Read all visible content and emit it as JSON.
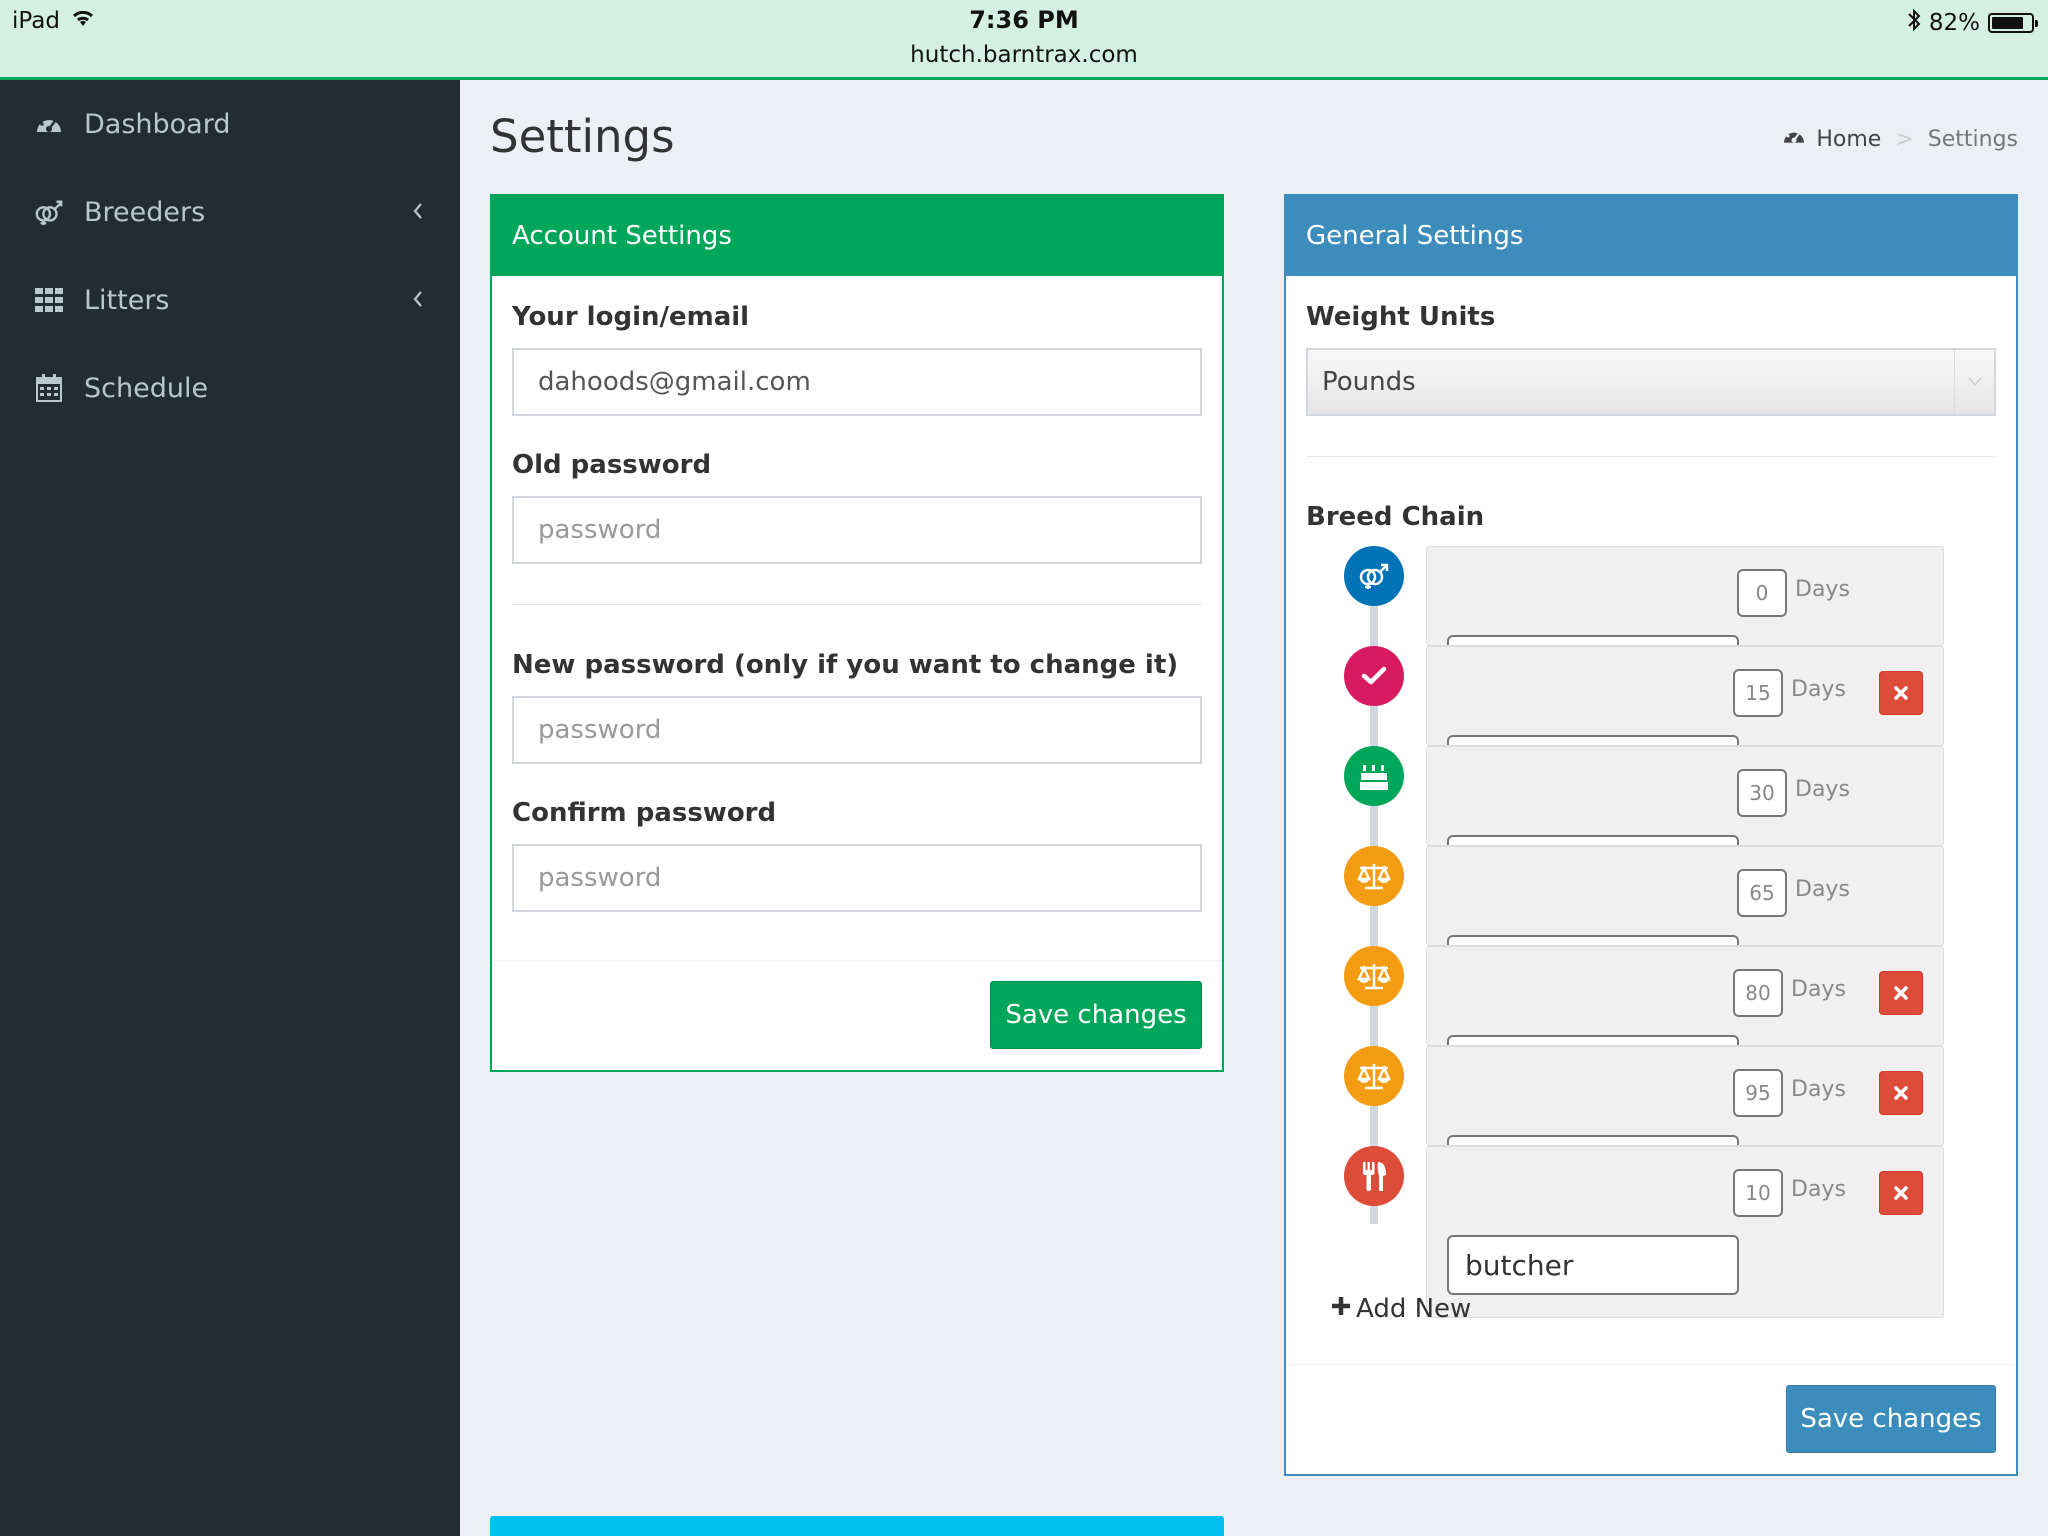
{
  "status_bar": {
    "device": "iPad",
    "time": "7:36 PM",
    "url": "hutch.barntrax.com",
    "battery": "82%",
    "battery_level": 0.82
  },
  "sidebar": {
    "items": [
      {
        "label": "Dashboard",
        "icon": "dashboard-icon"
      },
      {
        "label": "Breeders",
        "icon": "breeders-icon",
        "expandable": true
      },
      {
        "label": "Litters",
        "icon": "grid-icon",
        "expandable": true
      },
      {
        "label": "Schedule",
        "icon": "calendar-icon"
      }
    ]
  },
  "header": {
    "title": "Settings",
    "breadcrumb": {
      "home": "Home",
      "separator": ">",
      "current": "Settings"
    }
  },
  "account": {
    "title": "Account Settings",
    "email_label": "Your login/email",
    "email_value": "dahoods@gmail.com",
    "old_password_label": "Old password",
    "old_password_placeholder": "password",
    "new_password_label": "New password (only if you want to change it)",
    "new_password_placeholder": "password",
    "confirm_password_label": "Confirm password",
    "confirm_password_placeholder": "password",
    "save_label": "Save changes"
  },
  "general": {
    "title": "General Settings",
    "weight_units_label": "Weight Units",
    "weight_units_value": "Pounds",
    "breed_chain_label": "Breed Chain",
    "days_label": "Days",
    "add_new_label": "Add New",
    "save_label": "Save changes",
    "chain": [
      {
        "icon": "breed-icon",
        "color": "#0073b7",
        "days": "0",
        "removable": false,
        "name": ""
      },
      {
        "icon": "check-icon",
        "color": "#d81b60",
        "days": "15",
        "removable": true,
        "name": ""
      },
      {
        "icon": "birthday-cake-icon",
        "color": "#00a65a",
        "days": "30",
        "removable": false,
        "name": ""
      },
      {
        "icon": "balance-scale-icon",
        "color": "#f39c12",
        "days": "65",
        "removable": false,
        "name": ""
      },
      {
        "icon": "balance-scale-icon",
        "color": "#f39c12",
        "days": "80",
        "removable": true,
        "name": ""
      },
      {
        "icon": "balance-scale-icon",
        "color": "#f39c12",
        "days": "95",
        "removable": true,
        "name": ""
      },
      {
        "icon": "cutlery-icon",
        "color": "#dd4b39",
        "days": "10",
        "removable": true,
        "name": "butcher"
      }
    ]
  },
  "colors": {
    "sidebar_bg": "#222d32",
    "success": "#00a65a",
    "primary": "#3c8dbc",
    "danger": "#dd4b39",
    "warning": "#f39c12"
  }
}
